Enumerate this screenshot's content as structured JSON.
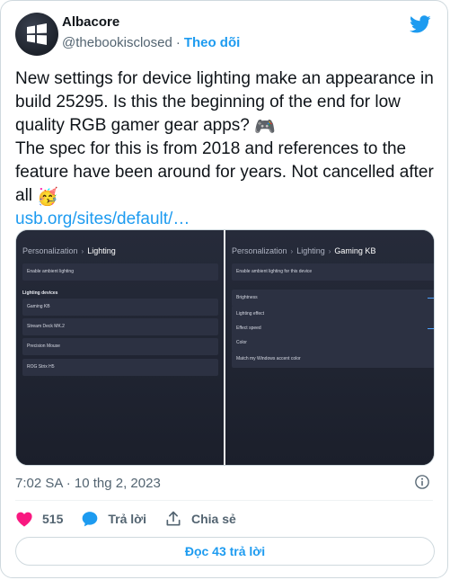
{
  "author": {
    "name": "Albacore",
    "handle": "@thebookisclosed",
    "separator": "·",
    "follow_label": "Theo dõi"
  },
  "tweet": {
    "line1": "New settings for device lighting make an appearance in build 25295. Is this the beginning of the end for low quality RGB gamer gear apps? ",
    "emoji1": "🎮",
    "line2": "The spec for this is from 2018 and references to the feature have been around for years. Not cancelled after all ",
    "emoji2": "🥳",
    "link": "usb.org/sites/default/…"
  },
  "media": {
    "left": {
      "crumb_root": "Personalization",
      "crumb_sep": "›",
      "crumb_current": "Lighting",
      "enable_row": "Enable ambient lighting",
      "section_label": "Lighting devices",
      "devices": [
        "Gaming KB",
        "Stream Deck MK.2",
        "Precision Mouse",
        "ROG Strix H5"
      ]
    },
    "right": {
      "crumb_root": "Personalization",
      "crumb_sep": "›",
      "crumb_mid": "Lighting",
      "crumb_current": "Gaming KB",
      "enable_row": "Enable ambient lighting for this device",
      "settings": [
        "Brightness",
        "Lighting effect",
        "Effect speed",
        "Color",
        "Match my Windows accent color"
      ]
    }
  },
  "meta": {
    "timestamp": "7:02 SA · 10 thg 2, 2023"
  },
  "actions": {
    "like_count": "515",
    "reply_label": "Trả lời",
    "share_label": "Chia sẻ",
    "read_replies_label": "Đọc 43 trả lời"
  },
  "colors": {
    "accent": "#1d9bf0",
    "like": "#f91880",
    "muted": "#536471"
  }
}
